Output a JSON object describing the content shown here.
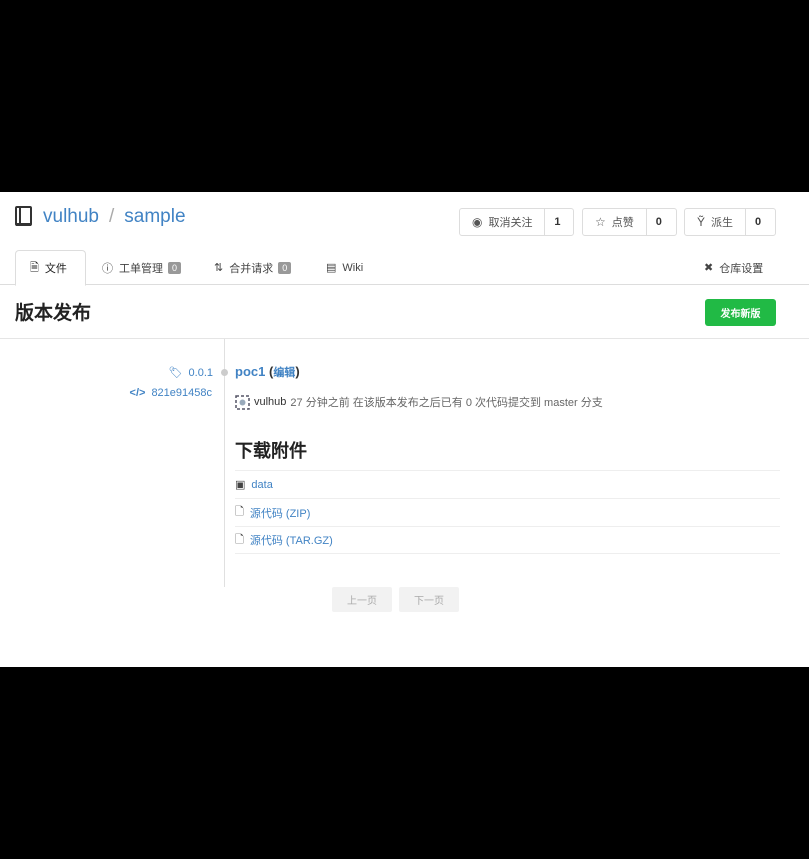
{
  "repo": {
    "owner": "vulhub",
    "separator": "/",
    "name": "sample"
  },
  "actions": {
    "watch": {
      "label": "取消关注",
      "count": "1"
    },
    "star": {
      "label": "点赞",
      "count": "0"
    },
    "fork": {
      "label": "派生",
      "count": "0"
    }
  },
  "tabs": {
    "files": {
      "label": "文件"
    },
    "issues": {
      "label": "工单管理",
      "count": "0"
    },
    "pulls": {
      "label": "合并请求",
      "count": "0"
    },
    "wiki": {
      "label": "Wiki"
    },
    "settings": {
      "label": "仓库设置"
    }
  },
  "page": {
    "title": "版本发布",
    "new_release": "发布新版"
  },
  "release": {
    "tag": "0.0.1",
    "commit": "821e91458c",
    "title": "poc1",
    "edit_open": "(",
    "edit_label": "编辑",
    "edit_close": ")",
    "author": "vulhub",
    "meta": "27 分钟之前 在该版本发布之后已有 0 次代码提交到 master 分支"
  },
  "downloads": {
    "heading": "下载附件",
    "items": [
      "data",
      "源代码 (ZIP)",
      "源代码 (TAR.GZ)"
    ]
  },
  "pager": {
    "prev": "上一页",
    "next": "下一页"
  },
  "colors": {
    "link": "#4183c4",
    "primary_button": "#21ba45"
  }
}
